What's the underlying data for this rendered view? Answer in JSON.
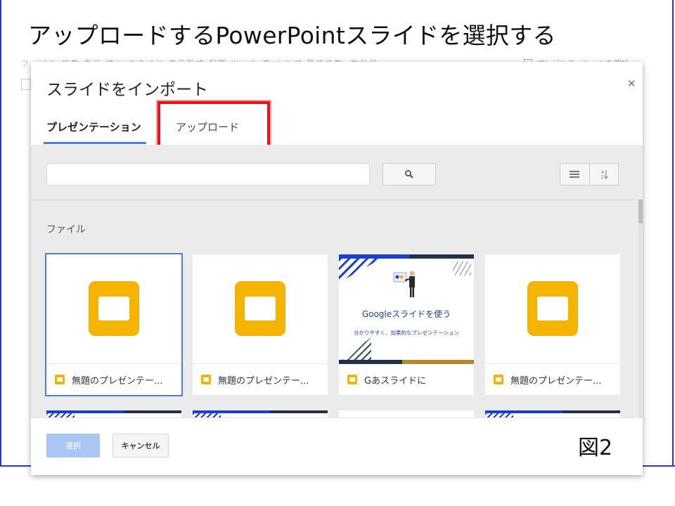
{
  "slide_title": "アップロードするPowerPointスライドを選択する",
  "figure_label": "図2",
  "background_app": {
    "menubar_text": "ファイル 編集 表示 挿入 スライド 表示形式 配置 ツール 表 ヘルプ 最終編集: 数秒前",
    "present_button": "プレゼンテーションを開始"
  },
  "dialog": {
    "title": "スライドをインポート",
    "close_icon": "close-icon",
    "tabs": [
      {
        "label": "プレゼンテーション",
        "active": true
      },
      {
        "label": "アップロード",
        "active": false,
        "highlighted": true
      }
    ],
    "search": {
      "placeholder": "",
      "button_icon": "search-icon"
    },
    "view_buttons": [
      "list-view-icon",
      "sort-az-icon"
    ],
    "section_label": "ファイル",
    "files": [
      {
        "name": "無題のプレゼンテー...",
        "thumbnail": "slides-logo",
        "selected": true
      },
      {
        "name": "無題のプレゼンテー...",
        "thumbnail": "slides-logo",
        "selected": false
      },
      {
        "name": "Gあスライドに",
        "thumbnail": "promo",
        "selected": false,
        "thumb_title": "Googleスライドを使う",
        "thumb_subtitle": "分かりやすく、効果的なプレゼンテーション"
      },
      {
        "name": "無題のプレゼンテー...",
        "thumbnail": "slides-logo",
        "selected": false
      }
    ],
    "buttons": {
      "select": "選択",
      "cancel": "キャンセル"
    }
  },
  "colors": {
    "accent_blue": "#4a7fde",
    "slides_yellow": "#f4b400",
    "highlight_red": "#e8141b",
    "frame_blue": "#2436d6"
  }
}
